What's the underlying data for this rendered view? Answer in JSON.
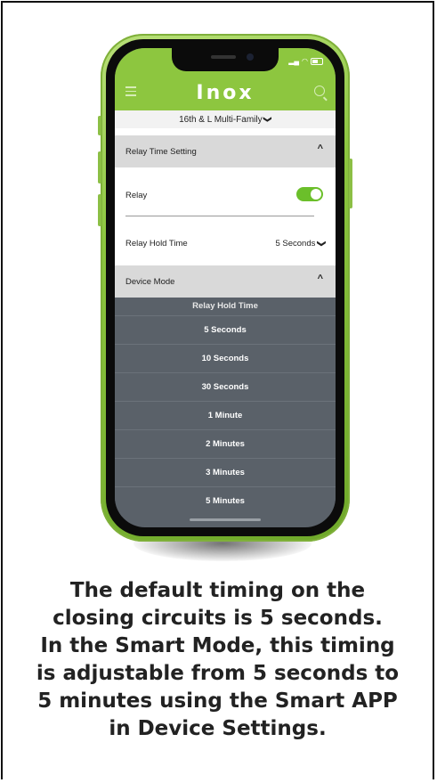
{
  "app": {
    "logo": "Inox",
    "site_selector": "16th & L Multi-Family",
    "site_chevron": "❯"
  },
  "relay_section": {
    "title": "Relay Time Setting",
    "caret": "^",
    "relay_label": "Relay",
    "relay_on": true,
    "hold_label": "Relay Hold Time",
    "hold_value": "5 Seconds"
  },
  "device_section": {
    "title": "Device Mode",
    "caret": "^"
  },
  "picker": {
    "title": "Relay Hold Time",
    "options": [
      "5 Seconds",
      "10 Seconds",
      "30 Seconds",
      "1 Minute",
      "2 Minutes",
      "3 Minutes",
      "5 Minutes"
    ]
  },
  "caption": {
    "line1": "The default timing on the",
    "line2": "closing circuits is 5 seconds.",
    "line3": "In the Smart Mode, this timing",
    "line4": "is adjustable from 5 seconds to",
    "line5": "5 minutes using the Smart APP",
    "line6": "in Device Settings."
  },
  "colors": {
    "brand_green": "#8dc63f",
    "toggle_on": "#6bbf2a",
    "picker_bg": "#5a6169"
  }
}
